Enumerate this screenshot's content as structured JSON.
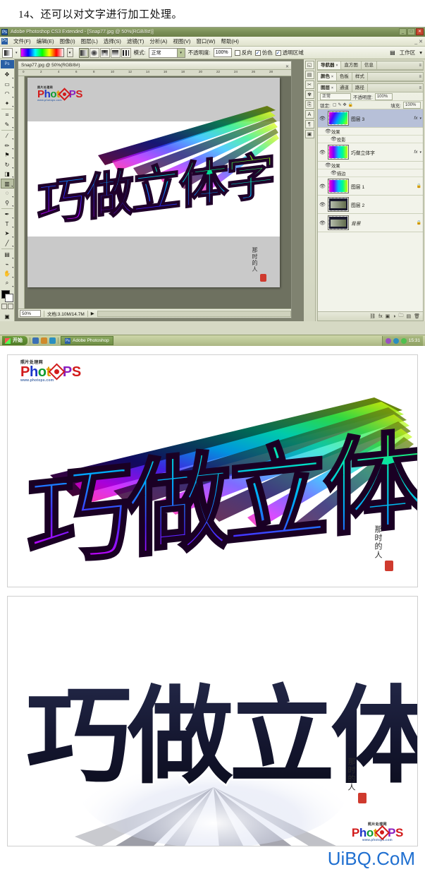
{
  "instruction": {
    "text": "14、还可以对文字进行加工处理。"
  },
  "photoshop": {
    "titlebar": {
      "app_icon": "Ps",
      "title": "Adobe Photoshop CS3 Extended - [Snap77.jpg @ 50%(RGB/8#)]",
      "buttons": {
        "minimize": "_",
        "restore": "□",
        "close": "✕"
      }
    },
    "menus": [
      "文件(F)",
      "编辑(E)",
      "图像(I)",
      "图层(L)",
      "选择(S)",
      "滤镜(T)",
      "分析(A)",
      "视图(V)",
      "窗口(W)",
      "帮助(H)"
    ],
    "menubar_right": "_ ✕",
    "options_bar": {
      "tool_icon": "gradient-tool-icon",
      "gradient_preset_label": "gradient-preview",
      "gradient_types": [
        "linear",
        "radial",
        "angle",
        "reflected",
        "diamond"
      ],
      "mode_label": "模式:",
      "mode_value": "正常",
      "opacity_label": "不透明度:",
      "opacity_value": "100%",
      "checkboxes": [
        {
          "label": "反向",
          "checked": false
        },
        {
          "label": "仿色",
          "checked": true
        },
        {
          "label": "透明区域",
          "checked": true
        }
      ],
      "workspace_label": "工作区",
      "workspace_caret": "▾"
    },
    "toolbar": {
      "logo": "Ps",
      "tools": [
        "move-tool",
        "marquee-tool",
        "lasso-tool",
        "magic-wand-tool",
        "crop-tool",
        "eyedropper-tool",
        "healing-brush-tool",
        "brush-tool",
        "clone-stamp-tool",
        "history-brush-tool",
        "eraser-tool",
        "gradient-tool",
        "blur-tool",
        "dodge-tool",
        "pen-tool",
        "type-tool",
        "path-selection-tool",
        "line-tool",
        "notes-tool",
        "hand-tool",
        "zoom-tool"
      ],
      "selected_tool": "gradient-tool",
      "foreground_color": "#000000",
      "background_color": "#ffffff"
    },
    "document": {
      "tab_title": "Snap77.jpg @ 50%(RGB/8#)",
      "tab_close": "✕",
      "ruler_ticks": [
        "0",
        "2",
        "4",
        "6",
        "8",
        "10",
        "12",
        "14",
        "16",
        "18",
        "20",
        "22",
        "24",
        "26",
        "28"
      ]
    },
    "statusbar": {
      "zoom": "50%",
      "doc_info": "文档:3.10M/14.7M",
      "arrow": "▶"
    },
    "panels": {
      "icon_dock": [
        "navigator-icon",
        "histogram-icon",
        "tool-preset-icon",
        "brushes-icon",
        "clone-source-icon",
        "character-icon",
        "paragraph-icon",
        "layer-comps-icon"
      ],
      "group_1_tabs": [
        {
          "label": "导航器",
          "active": true,
          "closable": true
        },
        {
          "label": "直方图",
          "active": false
        },
        {
          "label": "信息",
          "active": false
        }
      ],
      "group_2_tabs": [
        {
          "label": "颜色",
          "active": true,
          "closable": true
        },
        {
          "label": "色板",
          "active": false
        },
        {
          "label": "样式",
          "active": false
        }
      ],
      "group_3_tabs": [
        {
          "label": "图层",
          "active": true,
          "closable": true
        },
        {
          "label": "通道",
          "active": false
        },
        {
          "label": "路径",
          "active": false
        }
      ],
      "layers_controls": {
        "blend_mode": "正常",
        "opacity_label": "不透明度:",
        "opacity_value": "100%",
        "lock_label": "锁定:",
        "fill_label": "填充:",
        "fill_value": "100%"
      },
      "layers": [
        {
          "name": "图层 3",
          "visible": true,
          "selected": true,
          "fx_badge": "fx",
          "thumb": "rainbow-3d-thumb",
          "effects": [
            {
              "label": "效果"
            },
            {
              "label": "投影"
            }
          ]
        },
        {
          "name": "巧做立体字",
          "visible": true,
          "selected": false,
          "fx_badge": "fx",
          "thumb": "text-gradient-thumb",
          "effects": [
            {
              "label": "效果"
            },
            {
              "label": "描边"
            }
          ]
        },
        {
          "name": "图层 1",
          "visible": true,
          "selected": false,
          "lock_icon": "lock-icon",
          "thumb": "gradient-thumb",
          "effects": []
        },
        {
          "name": "图层 2",
          "visible": true,
          "selected": false,
          "thumb": "dark-art-thumb",
          "effects": []
        },
        {
          "name": "背景",
          "visible": true,
          "selected": false,
          "lock_icon": "lock-icon",
          "thumb": "background-thumb",
          "effects": []
        }
      ],
      "footer_buttons": [
        "link-layers",
        "add-layer-style",
        "add-layer-mask",
        "new-adjustment-layer",
        "new-group",
        "new-layer",
        "delete-layer"
      ]
    },
    "taskbar": {
      "start_label": "开始",
      "quick_launch": [
        "desktop-icon",
        "media-icon",
        "browser-icon"
      ],
      "tasks": [
        {
          "label": "Adobe Photoshop",
          "icon": "Ps"
        }
      ],
      "tray_time": "15:31"
    }
  },
  "artwork": {
    "text": "巧做立体字",
    "logo": {
      "cn_label": "照片处理网",
      "brand_prefix": "Phot",
      "brand_o": "O",
      "brand_suffix": "PS",
      "url": "www.photops.com"
    },
    "signature": {
      "strokes": "那时的人",
      "seal": "red-seal"
    }
  },
  "results": [
    {
      "name": "rainbow-3d-text-result",
      "text": "巧做立体字",
      "style": "rainbow-gradient-extruded"
    },
    {
      "name": "dark-beveled-text-result",
      "text": "巧做立体字",
      "style": "navy-with-white-outline-and-light-rays"
    }
  ],
  "watermark": {
    "text": "UiBQ.CoM",
    "color": "#1f6fd0"
  },
  "colors": {
    "desktop_green": "#d6d9c4",
    "titlebar_green": "#7b8f58",
    "selection_blue": "#b7c0d8",
    "canvas_gray": "#c9c9c9",
    "brand_blue": "#1f6fd0"
  }
}
